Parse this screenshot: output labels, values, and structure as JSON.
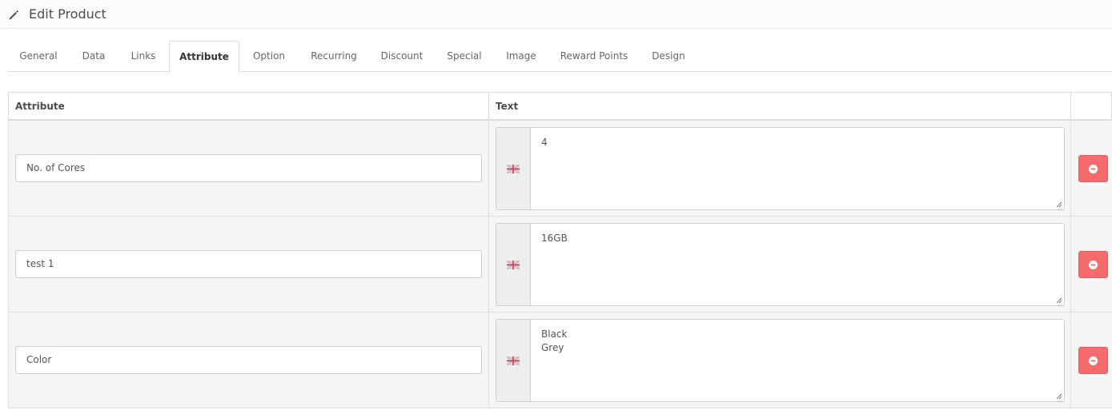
{
  "header": {
    "title": "Edit Product",
    "icon": "pencil-icon"
  },
  "tabs": [
    {
      "label": "General",
      "active": false
    },
    {
      "label": "Data",
      "active": false
    },
    {
      "label": "Links",
      "active": false
    },
    {
      "label": "Attribute",
      "active": true
    },
    {
      "label": "Option",
      "active": false
    },
    {
      "label": "Recurring",
      "active": false
    },
    {
      "label": "Discount",
      "active": false
    },
    {
      "label": "Special",
      "active": false
    },
    {
      "label": "Image",
      "active": false
    },
    {
      "label": "Reward Points",
      "active": false
    },
    {
      "label": "Design",
      "active": false
    }
  ],
  "table": {
    "columns": {
      "attribute": "Attribute",
      "text": "Text"
    },
    "rows": [
      {
        "attribute": "No. of Cores",
        "text": "4"
      },
      {
        "attribute": "test 1",
        "text": "16GB"
      },
      {
        "attribute": "Color",
        "text": "Black\nGrey"
      }
    ]
  },
  "colors": {
    "remove_button": "#f56b6b",
    "addon_bg": "#eeeeee",
    "row_bg": "#f5f5f5"
  }
}
